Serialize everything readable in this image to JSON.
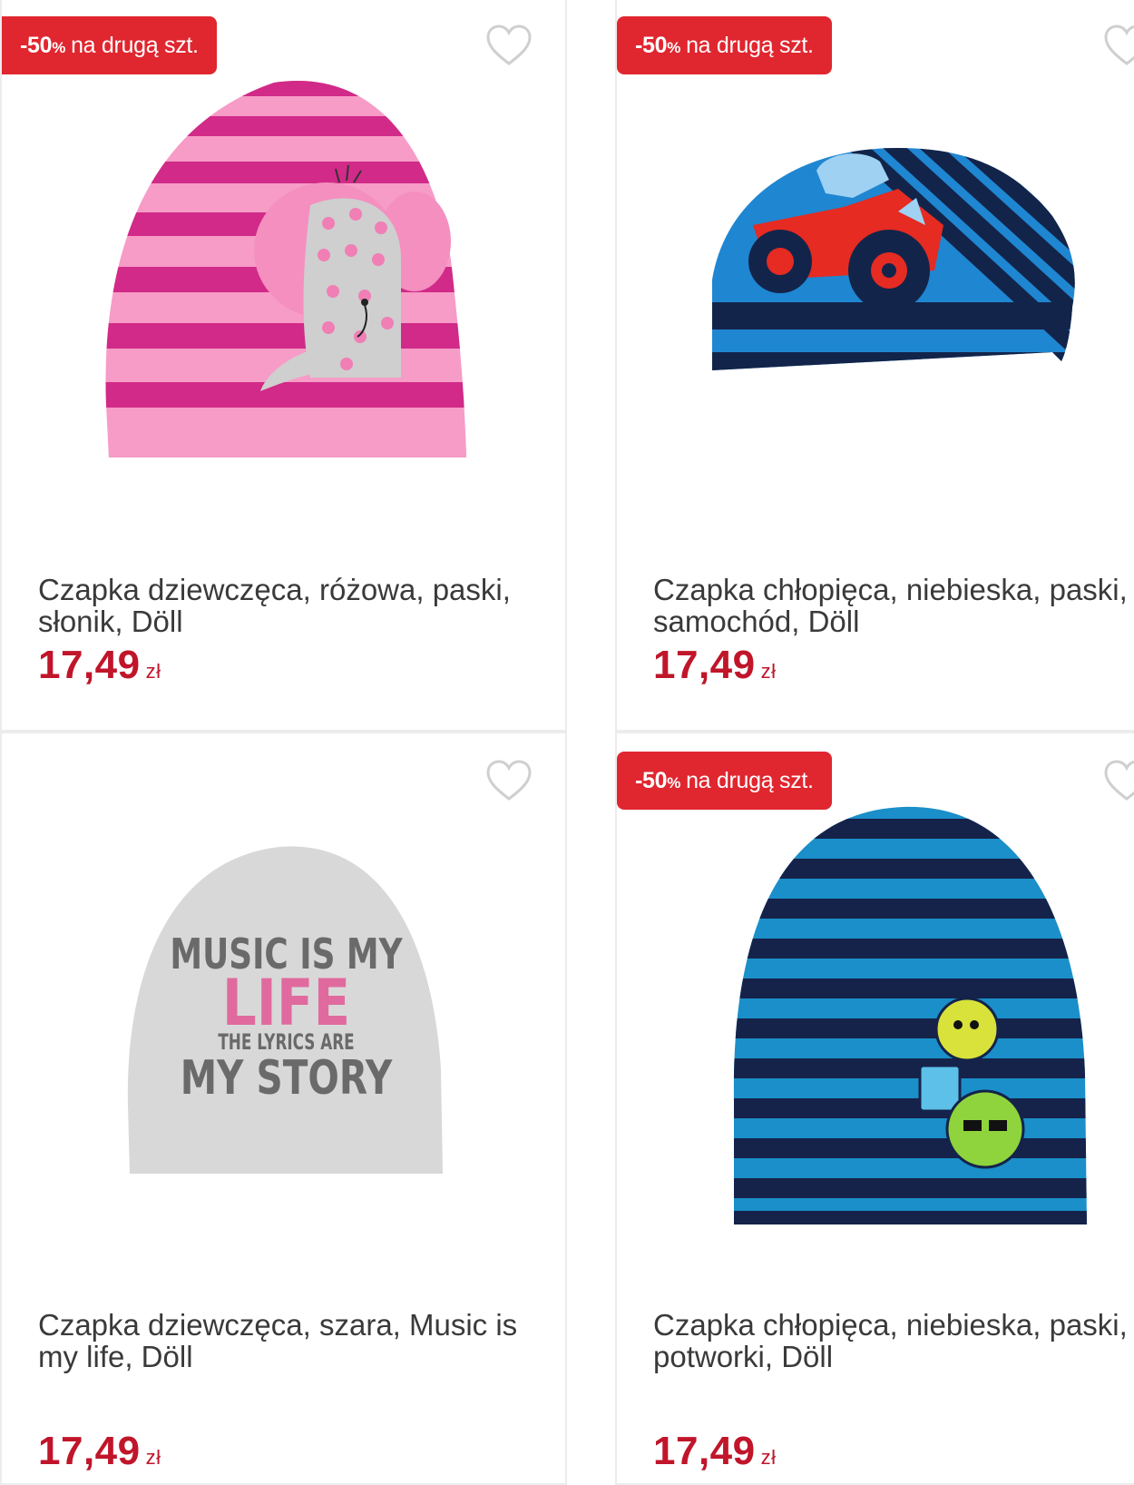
{
  "colors": {
    "promo_bg": "#e0262f",
    "price": "#c0152a",
    "text": "#3a3a3a"
  },
  "products": [
    {
      "promo_pct": "-50",
      "promo_pct_sign": "%",
      "promo_text": "na drugą szt.",
      "name": "Czapka dziewczęca, różowa, paski, słonik, Döll",
      "price": "17,49",
      "currency": "zł"
    },
    {
      "promo_pct": "-50",
      "promo_pct_sign": "%",
      "promo_text": "na drugą szt.",
      "name": "Czapka chłopięca, niebieska, paski, samochód, Döll",
      "price": "17,49",
      "currency": "zł"
    },
    {
      "name": "Czapka dziewczęca, szara, Music is my life, Döll",
      "price": "17,49",
      "currency": "zł",
      "print_lines": [
        "MUSIC IS MY",
        "LIFE",
        "THE LYRICS ARE",
        "MY STORY"
      ]
    },
    {
      "promo_pct": "-50",
      "promo_pct_sign": "%",
      "promo_text": "na drugą szt.",
      "name": "Czapka chłopięca, niebieska, paski, potworki, Döll",
      "price": "17,49",
      "currency": "zł"
    }
  ]
}
